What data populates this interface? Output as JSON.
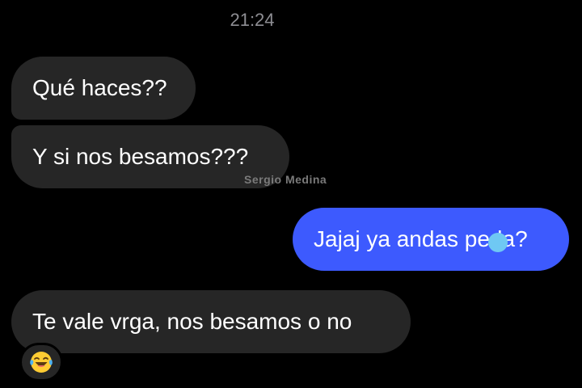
{
  "thread": {
    "timestamp": "21:24",
    "watermark": "Sergio Medina",
    "messages": [
      {
        "direction": "incoming",
        "text": "Qué haces??"
      },
      {
        "direction": "incoming",
        "text": "Y si nos besamos???"
      },
      {
        "direction": "outgoing",
        "text": "Jajaj ya andas peda?"
      },
      {
        "direction": "incoming",
        "text": "Te vale vrga, nos besamos o no"
      }
    ],
    "reaction": {
      "icon": "laughing-tears-emoji-icon"
    }
  },
  "colors": {
    "background": "#000000",
    "incoming_bubble": "#262626",
    "outgoing_bubble": "#3d5afe",
    "timestamp_text": "#8e8e93"
  }
}
